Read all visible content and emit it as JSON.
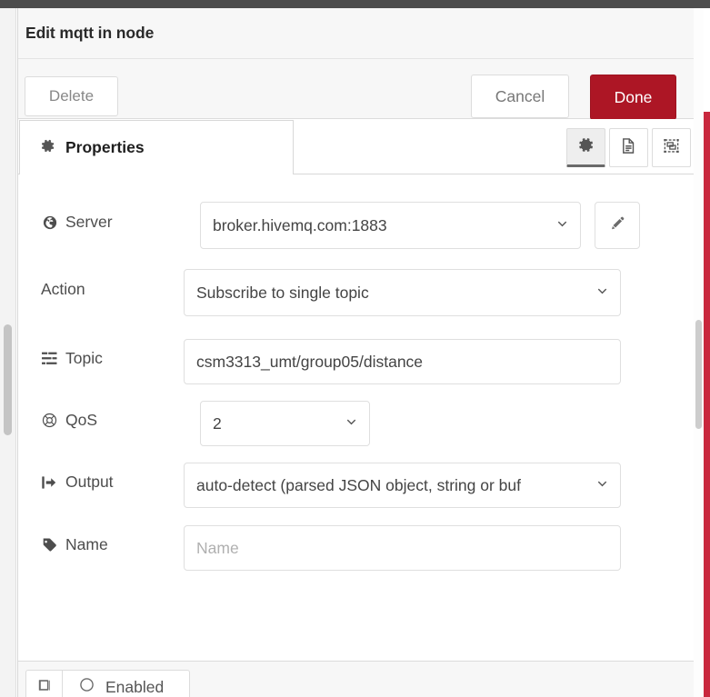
{
  "dialog": {
    "title": "Edit mqtt in node",
    "buttons": {
      "delete": "Delete",
      "cancel": "Cancel",
      "done": "Done"
    },
    "colors": {
      "done_background": "#ad1625",
      "palette_edge": "#c9283e",
      "titlebar_background": "#f7f7f7",
      "active_tab_background": "#eeeeee"
    }
  },
  "tabs": {
    "properties": {
      "label": "Properties",
      "icon": "gear-icon",
      "active": true
    },
    "icon_buttons": [
      {
        "name": "gear-icon",
        "title": "Properties",
        "active": true
      },
      {
        "name": "description-icon",
        "title": "Description",
        "active": false
      },
      {
        "name": "appearance-icon",
        "title": "Appearance",
        "active": false
      }
    ]
  },
  "form": {
    "rows": [
      {
        "key": "server",
        "label": "Server",
        "icon": "globe-icon",
        "control": "select",
        "value": "broker.hivemq.com:1883",
        "has_edit_button": true,
        "edit_button_icon": "pencil-icon"
      },
      {
        "key": "action",
        "label": "Action",
        "icon": "none",
        "control": "select",
        "value": "Subscribe to single topic"
      },
      {
        "key": "topic",
        "label": "Topic",
        "icon": "tasks-icon",
        "control": "text",
        "value": "csm3313_umt/group05/distance"
      },
      {
        "key": "qos",
        "label": "QoS",
        "icon": "life-ring-icon",
        "control": "select",
        "value": "2"
      },
      {
        "key": "output",
        "label": "Output",
        "icon": "sign-out-icon",
        "control": "select",
        "value": "auto-detect (parsed JSON object, string or buf"
      },
      {
        "key": "name",
        "label": "Name",
        "icon": "tag-icon",
        "control": "text",
        "value": "",
        "placeholder": "Name"
      }
    ]
  },
  "footer": {
    "book_button_icon": "book-icon",
    "enabled_toggle": {
      "icon": "circle-icon",
      "label": "Enabled"
    }
  }
}
